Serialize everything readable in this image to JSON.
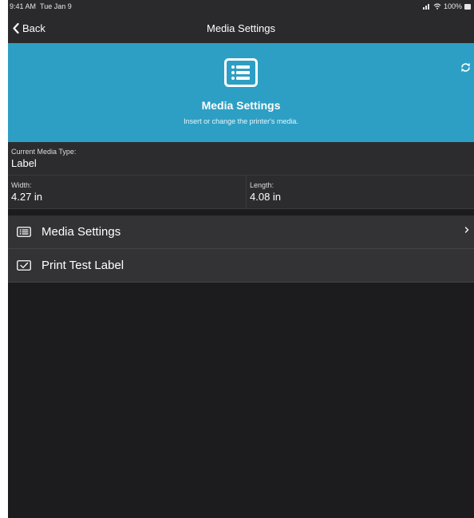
{
  "status_bar": {
    "time": "9:41 AM",
    "date": "Tue Jan 9",
    "battery": "100%"
  },
  "nav": {
    "back_label": "Back",
    "title": "Media Settings"
  },
  "hero": {
    "title": "Media Settings",
    "subtitle": "Insert or change the printer's media.",
    "background": "#2d9fc4",
    "icon": "list-icon"
  },
  "info": {
    "media_type_label": "Current Media Type:",
    "media_type_value": "Label",
    "width_label": "Width:",
    "width_value": "4.27 in",
    "length_label": "Length:",
    "length_value": "4.08 in"
  },
  "menu": {
    "items": [
      {
        "label": "Media Settings",
        "icon": "list-icon",
        "has_chevron": true
      },
      {
        "label": "Print Test Label",
        "icon": "checkbox-icon",
        "has_chevron": false
      }
    ]
  }
}
